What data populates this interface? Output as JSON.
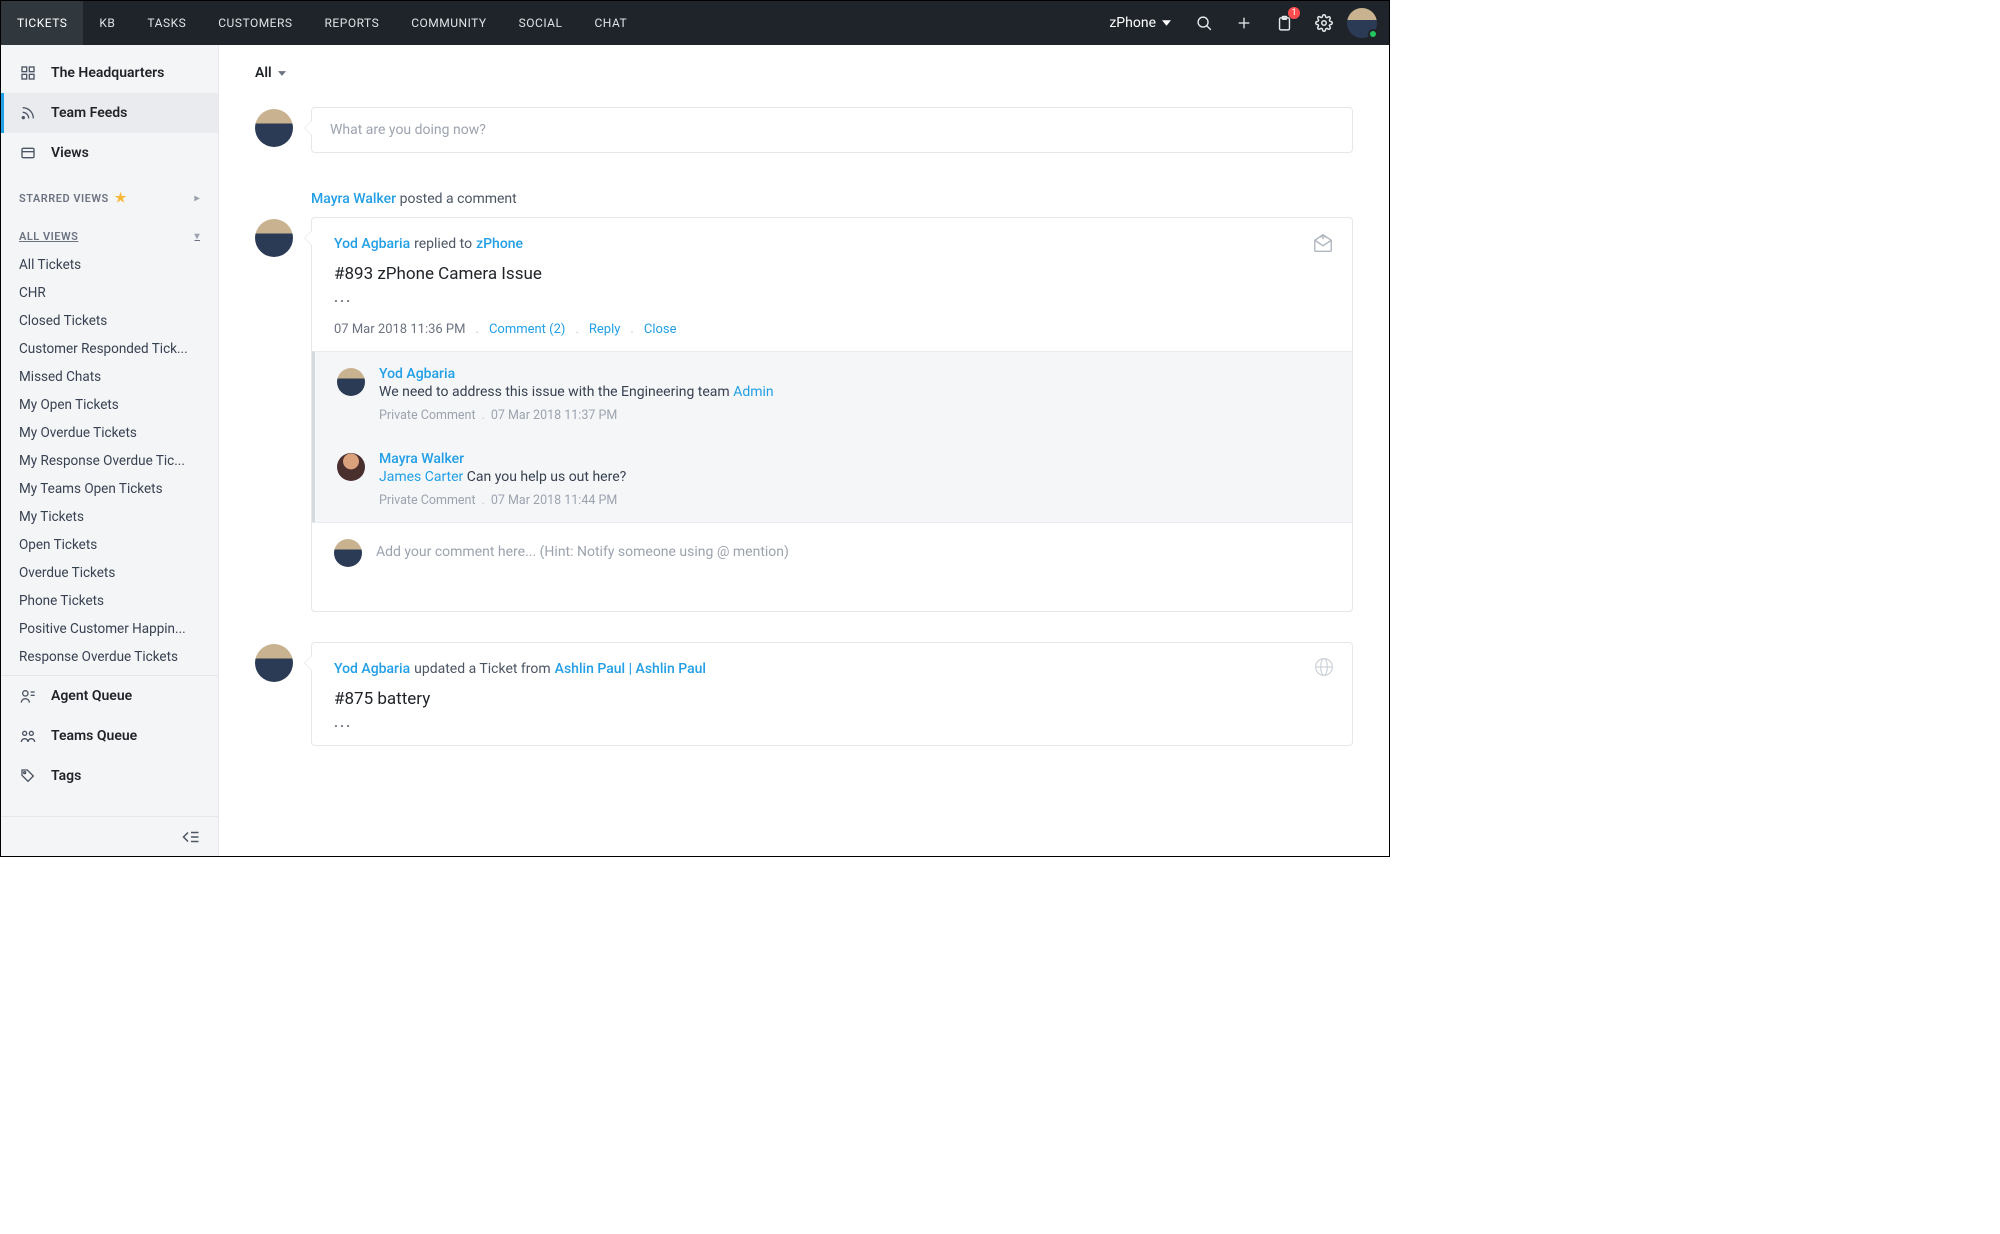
{
  "topnav": {
    "items": [
      "TICKETS",
      "KB",
      "TASKS",
      "CUSTOMERS",
      "REPORTS",
      "COMMUNITY",
      "SOCIAL",
      "CHAT"
    ],
    "active_index": 0,
    "brand": "zPhone",
    "badge_count": "1"
  },
  "sidebar": {
    "primary": [
      {
        "label": "The Headquarters",
        "icon": "grid-icon"
      },
      {
        "label": "Team Feeds",
        "icon": "feed-icon"
      },
      {
        "label": "Views",
        "icon": "views-icon"
      }
    ],
    "primary_active_index": 1,
    "starred_header": "STARRED VIEWS",
    "all_views_header": "ALL VIEWS",
    "all_views": [
      "All Tickets",
      "CHR",
      "Closed Tickets",
      "Customer Responded Tick...",
      "Missed Chats",
      "My Open Tickets",
      "My Overdue Tickets",
      "My Response Overdue Tic...",
      "My Teams Open Tickets",
      "My Tickets",
      "Open Tickets",
      "Overdue Tickets",
      "Phone Tickets",
      "Positive Customer Happin...",
      "Response Overdue Tickets"
    ],
    "lower": [
      {
        "label": "Agent Queue",
        "icon": "agent-queue-icon"
      },
      {
        "label": "Teams Queue",
        "icon": "teams-queue-icon"
      },
      {
        "label": "Tags",
        "icon": "tags-icon"
      }
    ]
  },
  "main": {
    "filter": "All",
    "composer_placeholder": "What are you doing now?",
    "comment_placeholder": "Add your comment here... (Hint: Notify someone using @ mention)"
  },
  "feed": [
    {
      "preline": {
        "user": "Mayra Walker",
        "action": "posted a comment"
      },
      "headline": {
        "user": "Yod Agbaria",
        "action": "replied to",
        "target": "zPhone"
      },
      "ticket_title": "#893 zPhone Camera Issue",
      "ellipsis": "...",
      "timestamp": "07 Mar 2018 11:36 PM",
      "actions": {
        "comment": "Comment (2)",
        "reply": "Reply",
        "close": "Close"
      },
      "icon": "email-open-icon",
      "comments": [
        {
          "user": "Yod Agbaria",
          "text": "We need to address this issue with the Engineering team ",
          "mention": "Admin",
          "meta_label": "Private Comment",
          "meta_time": "07 Mar 2018 11:37 PM",
          "avatar": "male"
        },
        {
          "user": "Mayra Walker",
          "mention_lead": "James Carter",
          "text_after": " Can you help us out here?",
          "meta_label": "Private Comment",
          "meta_time": "07 Mar 2018 11:44 PM",
          "avatar": "female"
        }
      ]
    },
    {
      "headline": {
        "user": "Yod Agbaria",
        "action": "updated a Ticket from",
        "target": "Ashlin Paul | Ashlin Paul"
      },
      "ticket_title": "#875 battery",
      "ellipsis": "...",
      "icon": "globe-icon"
    }
  ]
}
